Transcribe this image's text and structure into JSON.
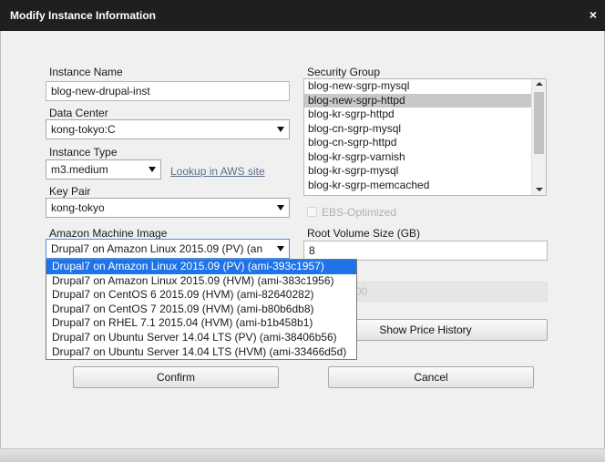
{
  "window": {
    "title": "Modify Instance Information",
    "close_glyph": "×"
  },
  "form": {
    "instance_name": {
      "label": "Instance Name",
      "value": "blog-new-drupal-inst"
    },
    "data_center": {
      "label": "Data Center",
      "value": "kong-tokyo:C"
    },
    "instance_type": {
      "label": "Instance Type",
      "value": "m3.medium",
      "link": "Lookup in AWS site"
    },
    "key_pair": {
      "label": "Key Pair",
      "value": "kong-tokyo"
    },
    "ami": {
      "label": "Amazon Machine Image",
      "value": "Drupal7 on Amazon Linux 2015.09 (PV) (an",
      "options": [
        "Drupal7 on Amazon Linux 2015.09 (PV) (ami-393c1957)",
        "Drupal7 on Amazon Linux 2015.09 (HVM) (ami-383c1956)",
        "Drupal7 on CentOS 6 2015.09 (HVM) (ami-82640282)",
        "Drupal7 on CentOS 7 2015.09 (HVM) (ami-b80b6db8)",
        "Drupal7 on RHEL 7.1 2015.04 (HVM) (ami-b1b458b1)",
        "Drupal7 on Ubuntu Server 14.04 LTS (PV) (ami-38406b56)",
        "Drupal7 on Ubuntu Server 14.04 LTS (HVM) (ami-33466d5d)"
      ],
      "selected_index": 0
    },
    "security_group": {
      "label": "Security Group",
      "items": [
        "blog-new-sgrp-mysql",
        "blog-new-sgrp-httpd",
        "blog-kr-sgrp-httpd",
        "blog-cn-sgrp-mysql",
        "blog-cn-sgrp-httpd",
        "blog-kr-sgrp-varnish",
        "blog-kr-sgrp-mysql",
        "blog-kr-sgrp-memcached"
      ],
      "selected_index": 1
    },
    "ebs_optimized": {
      "label": "EBS-Optimized",
      "checked": false,
      "enabled": false
    },
    "root_volume": {
      "label": "Root Volume Size (GB)",
      "value": "8"
    },
    "hidden_field": {
      "label_fragment": "e",
      "value_fragment": "00"
    },
    "price_history_button": "Show Price History"
  },
  "actions": {
    "confirm": "Confirm",
    "cancel": "Cancel"
  },
  "colors": {
    "titlebar": "#1f1f1f",
    "background": "#f0f0f0",
    "dropdown_highlight": "#1e73e8",
    "listbox_selected": "#c8c8c8",
    "link": "#5e6f8a"
  }
}
